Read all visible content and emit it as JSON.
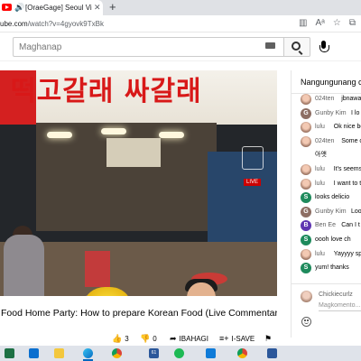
{
  "browser": {
    "tab_title": "[OraeGage] Seoul Virtual Tour",
    "tab_close": "✕",
    "new_tab": "+",
    "url_host": "ube.com",
    "url_path": "/watch?v=4gyovk9TxBk"
  },
  "youtube": {
    "search_placeholder": "Maghanap",
    "video_title": "Food Home Party: How to prepare Korean Food (Live Commentary)",
    "sign_text": "떡고갈래 싸갈래",
    "live_badge": "LIVE",
    "actions": {
      "like_icon": "👍",
      "like_count": "3",
      "dislike_icon": "👎",
      "dislike_count": "0",
      "share_icon": "➦",
      "share_label": "IBAHAGI",
      "save_icon": "≡+",
      "save_label": "I-SAVE",
      "flag_icon": "⚑"
    }
  },
  "chat": {
    "mode_label": "Nangungunang ch",
    "messages": [
      {
        "author": "024ten",
        "text": "jbnawa",
        "avatar": "photo",
        "color": "#9a7a6a"
      },
      {
        "author": "Gunby Kim",
        "text": "I lo",
        "avatar": "G",
        "color": "#8d6e63"
      },
      {
        "author": "lulu",
        "text": "Ok nice be",
        "avatar": "photo",
        "color": "#9a7a6a"
      },
      {
        "author": "024ten",
        "text": "Some c",
        "avatar": "photo",
        "color": "#7e57c2"
      },
      {
        "author": "",
        "text": "아앳",
        "avatar": "",
        "color": ""
      },
      {
        "author": "lulu",
        "text": "It's seems",
        "avatar": "photo",
        "color": "#9a7a6a"
      },
      {
        "author": "lulu",
        "text": "I want to tr",
        "avatar": "photo",
        "color": "#9a7a6a"
      },
      {
        "author": "S",
        "text": "looks delicio",
        "avatar": "S",
        "color": "#1e8a5c"
      },
      {
        "author": "Gunby Kim",
        "text": "Loo",
        "avatar": "G",
        "color": "#8d6e63"
      },
      {
        "author": "Ben Ee",
        "text": "Can I t",
        "avatar": "B",
        "color": "#5e35b1"
      },
      {
        "author": "S",
        "text": "oooh love ch",
        "avatar": "S",
        "color": "#1e8a5c"
      },
      {
        "author": "lulu",
        "text": "Yayyyy spi",
        "avatar": "photo",
        "color": "#9a7a6a"
      },
      {
        "author": "S",
        "text": "yum! thanks",
        "avatar": "S",
        "color": "#1e8a5c"
      }
    ],
    "user_name": "Chickiecurlz",
    "input_placeholder": "Magkomento..."
  },
  "taskbar": {
    "calendar_badge": "61"
  }
}
